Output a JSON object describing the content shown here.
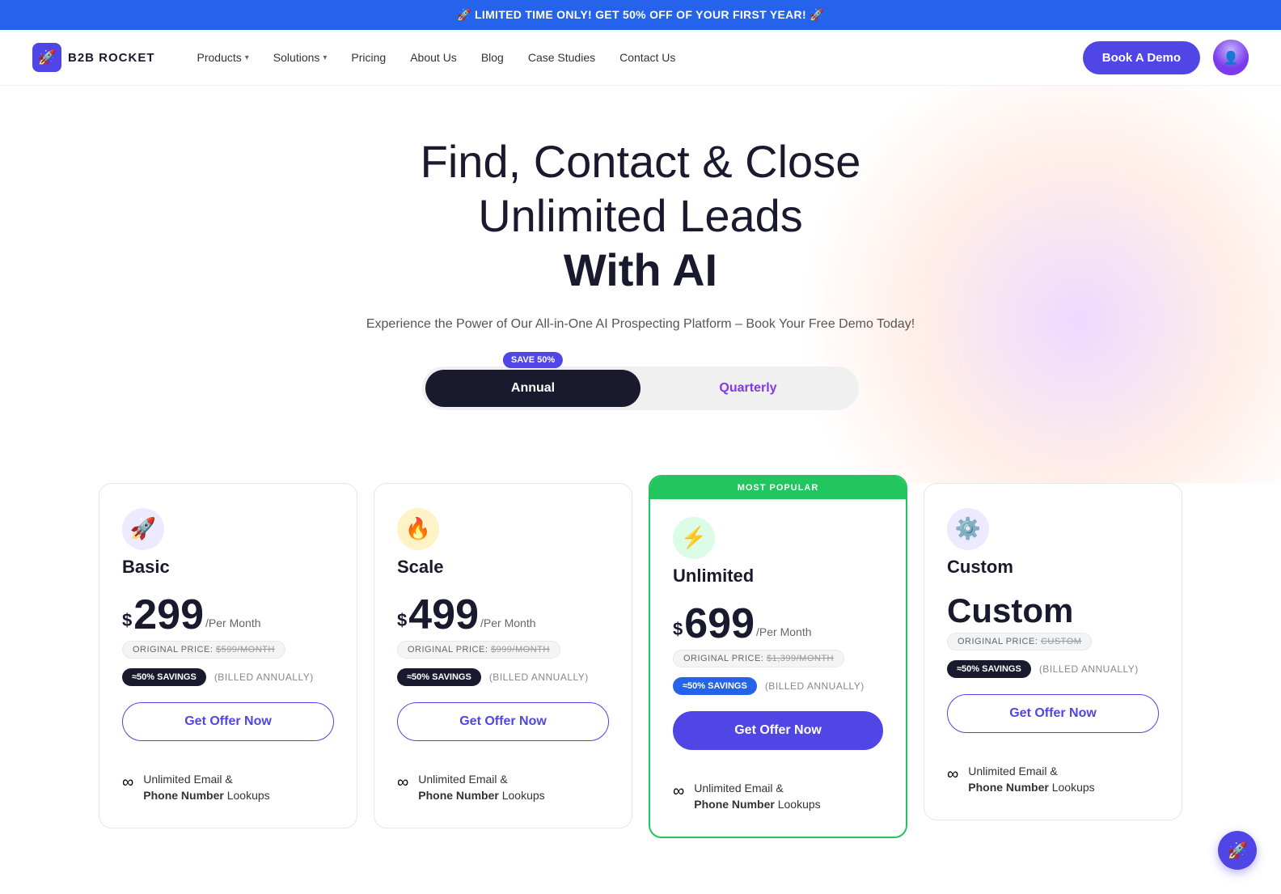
{
  "banner": {
    "text": "🚀 LIMITED TIME ONLY! GET 50% OFF OF YOUR FIRST YEAR! 🚀"
  },
  "nav": {
    "logo_text": "B2B ROCKET",
    "links": [
      {
        "label": "Products",
        "has_dropdown": true
      },
      {
        "label": "Solutions",
        "has_dropdown": true
      },
      {
        "label": "Pricing",
        "has_dropdown": false
      },
      {
        "label": "About Us",
        "has_dropdown": false
      },
      {
        "label": "Blog",
        "has_dropdown": false
      },
      {
        "label": "Case Studies",
        "has_dropdown": false
      },
      {
        "label": "Contact Us",
        "has_dropdown": false
      }
    ],
    "cta_label": "Book A Demo"
  },
  "hero": {
    "title_line1": "Find, Contact & Close",
    "title_line2": "Unlimited Leads",
    "title_line3_bold": "With AI",
    "subtitle": "Experience the Power of Our All-in-One AI Prospecting Platform – Book Your Free Demo Today!"
  },
  "toggle": {
    "save_badge": "SAVE 50%",
    "annual_label": "Annual",
    "quarterly_label": "Quarterly",
    "active": "annual"
  },
  "pricing": {
    "plans": [
      {
        "id": "basic",
        "icon": "🚀",
        "icon_color": "#7c3aed",
        "name": "Basic",
        "price": "299",
        "period": "/Per Month",
        "original_price_label": "ORIGINAL PRICE:",
        "original_price": "$599/MONTH",
        "savings_label": "≈50% SAVINGS",
        "billed_label": "(BILLED ANNUALLY)",
        "cta_label": "Get Offer Now",
        "feature_text": "Unlimited Email &",
        "feature_text2": "Phone Number",
        "feature_text3": "Lookups",
        "is_popular": false
      },
      {
        "id": "scale",
        "icon": "🔥",
        "icon_color": "#f97316",
        "name": "Scale",
        "price": "499",
        "period": "/Per Month",
        "original_price_label": "ORIGINAL PRICE:",
        "original_price": "$999/MONTH",
        "savings_label": "≈50% SAVINGS",
        "billed_label": "(BILLED ANNUALLY)",
        "cta_label": "Get Offer Now",
        "feature_text": "Unlimited Email &",
        "feature_text2": "Phone Number",
        "feature_text3": "Lookups",
        "is_popular": false
      },
      {
        "id": "unlimited",
        "icon": "⚡",
        "icon_color": "#22c55e",
        "name": "Unlimited",
        "price": "699",
        "period": "/Per Month",
        "original_price_label": "ORIGINAL PRICE:",
        "original_price": "$1,399/MONTH",
        "savings_label": "≈50% SAVINGS",
        "billed_label": "(BILLED ANNUALLY)",
        "cta_label": "Get Offer Now",
        "feature_text": "Unlimited Email &",
        "feature_text2": "Phone Number",
        "feature_text3": "Lookups",
        "is_popular": true,
        "popular_label": "MOST POPULAR"
      },
      {
        "id": "custom",
        "icon": "⚙️",
        "icon_color": "#6366f1",
        "name": "Custom",
        "price": "Custom",
        "period": "",
        "original_price_label": "ORIGINAL PRICE:",
        "original_price": "CUSTOM",
        "savings_label": "≈50% SAVINGS",
        "billed_label": "(BILLED ANNUALLY)",
        "cta_label": "Get Offer Now",
        "feature_text": "Unlimited Email &",
        "feature_text2": "Phone Number",
        "feature_text3": "Lookups",
        "is_popular": false
      }
    ]
  },
  "chat": {
    "icon": "🚀"
  }
}
